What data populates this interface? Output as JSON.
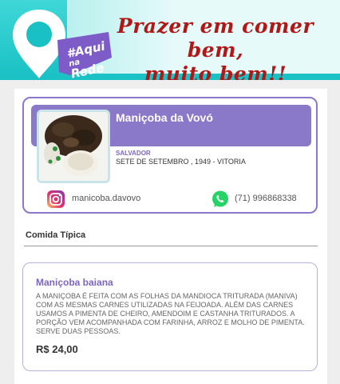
{
  "header": {
    "logo": {
      "line1": "#Aqui",
      "line2": "na",
      "line3": "Rede",
      "icon": "map-pin-logo"
    },
    "tagline_line1": "Prazer em comer bem,",
    "tagline_line2": "muito bem!!"
  },
  "business": {
    "name": "Maniçoba da Vovó",
    "city": "SALVADOR",
    "address": "SETE DE SETEMBRO , 1949 - VITORIA",
    "instagram": "manicoba.davovo",
    "phone": "(71) 996868338",
    "photo": "manicoba-dish-photo"
  },
  "section": {
    "title": "Comida Típica"
  },
  "dish": {
    "name": "Maniçoba baiana",
    "description": "A MANIÇOBA É FEITA COM AS FOLHAS DA MANDIOCA TRITURADA (MANIVA) COM AS MESMAS CARNES UTILIZADAS NA FEIJOADA. ALÉM DAS CARNES USAMOS A PIMENTA DE CHEIRO, AMENDOIM E CASTANHA TRITURADOS. A PORÇÃO VEM ACOMPANHADA COM FARINHA, ARROZ E MOLHO DE PIMENTA. SERVE DUAS PESSOAS.",
    "price": "R$ 24,00"
  },
  "colors": {
    "accent": "#8a78c8",
    "banner": "#19c0c4",
    "tagline": "#b01818"
  }
}
